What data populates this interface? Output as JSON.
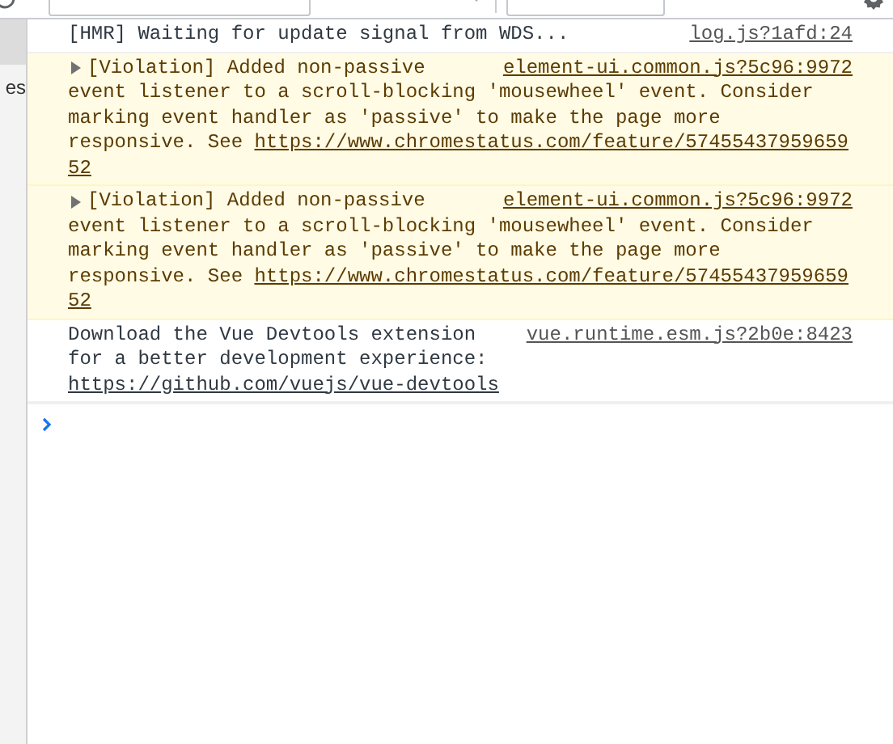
{
  "sidebar": {
    "items": [
      {
        "selected": true
      },
      {
        "label": "es",
        "selected": false
      }
    ]
  },
  "messages": [
    {
      "kind": "info",
      "text": "[HMR] Waiting for update signal from WDS...",
      "source": "log.js?1afd:24"
    },
    {
      "kind": "violation",
      "expanded": false,
      "lead": "[Violation] Added non-passive",
      "text": "event listener to a scroll-blocking 'mousewheel' event. Consider marking event handler as 'passive' to make the page more responsive. See ",
      "url": "https://www.chromestatus.com/feature/5745543795965952",
      "source": "element-ui.common.js?5c96:9972"
    },
    {
      "kind": "violation",
      "expanded": false,
      "lead": "[Violation] Added non-passive",
      "text": "event listener to a scroll-blocking 'mousewheel' event. Consider marking event handler as 'passive' to make the page more responsive. See ",
      "url": "https://www.chromestatus.com/feature/5745543795965952",
      "source": "element-ui.common.js?5c96:9972"
    },
    {
      "kind": "info",
      "lead": "Download the Vue Devtools extension",
      "text": "for a better development experience:\n",
      "url": "https://github.com/vuejs/vue-devtools",
      "source": "vue.runtime.esm.js?2b0e:8423"
    }
  ]
}
